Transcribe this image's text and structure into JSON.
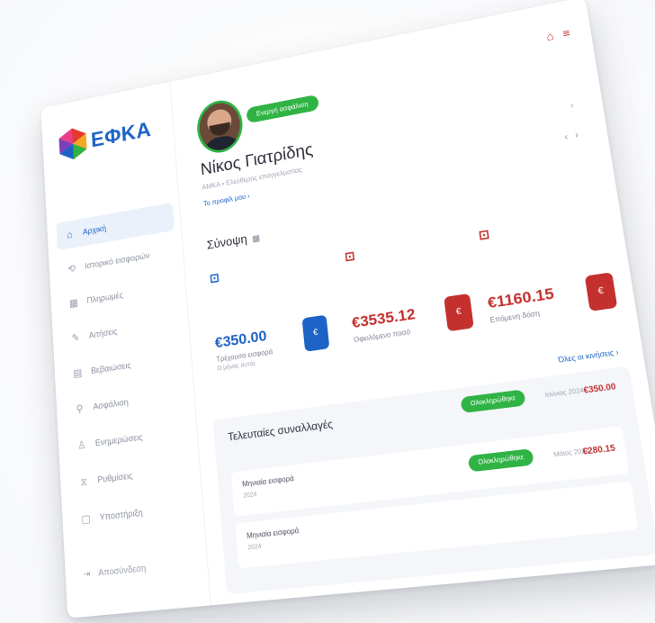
{
  "app": {
    "logo_text": "ΕΦΚΑ",
    "accent": "#1c63c5",
    "positive": "#2fb344",
    "negative": "#c3302e"
  },
  "sidebar": {
    "items": [
      {
        "label": "Αρχική",
        "icon": "home-icon",
        "active": true
      },
      {
        "label": "Ιστορικό εισφορών",
        "icon": "history-icon"
      },
      {
        "label": "Πληρωμές",
        "icon": "calendar-icon"
      },
      {
        "label": "Αιτήσεις",
        "icon": "pen-icon"
      },
      {
        "label": "Βεβαιώσεις",
        "icon": "document-icon"
      },
      {
        "label": "Ασφάλιση",
        "icon": "shield-icon"
      },
      {
        "label": "Ενημερώσεις",
        "icon": "people-icon"
      },
      {
        "label": "Ρυθμίσεις",
        "icon": "settings-icon"
      },
      {
        "label": "Υποστήριξη",
        "icon": "help-icon"
      }
    ],
    "logout": "Αποσύνδεση"
  },
  "header": {
    "badge": "Ενεργή ασφάλιση",
    "user_name": "Νίκος Γιατρίδης",
    "user_meta": "ΑΜΚΑ • Ελεύθερος επαγγελματίας",
    "user_link": "Το προφίλ μου ›"
  },
  "summary": {
    "title": "Σύνοψη",
    "see_all": "Όλες οι κινήσεις ›",
    "kpis": [
      {
        "amount": "€350.00",
        "label": "Τρέχουσα εισφορά",
        "sub": "Ο μήνας αυτός",
        "color": "#1c63c5"
      },
      {
        "amount": "€3535.12",
        "label": "Οφειλόμενο ποσό",
        "sub": "",
        "color": "#c3302e"
      },
      {
        "amount": "€1160.15",
        "label": "Επόμενη δόση",
        "sub": "",
        "color": "#c3302e"
      }
    ]
  },
  "transactions": {
    "title": "Τελευταίες συναλλαγές",
    "rows": [
      {
        "name": "",
        "date": "",
        "status": "Ολοκληρώθηκε",
        "meta": "Ιούνιος 2024",
        "amount": "€350.00"
      },
      {
        "name": "Μηνιαία εισφορά",
        "date": "2024",
        "status": "Ολοκληρώθηκε",
        "meta": "Μάιος 2024",
        "amount": "€280.15"
      },
      {
        "name": "Μηνιαία εισφορά",
        "date": "2024",
        "status": "",
        "meta": "",
        "amount": ""
      }
    ]
  }
}
